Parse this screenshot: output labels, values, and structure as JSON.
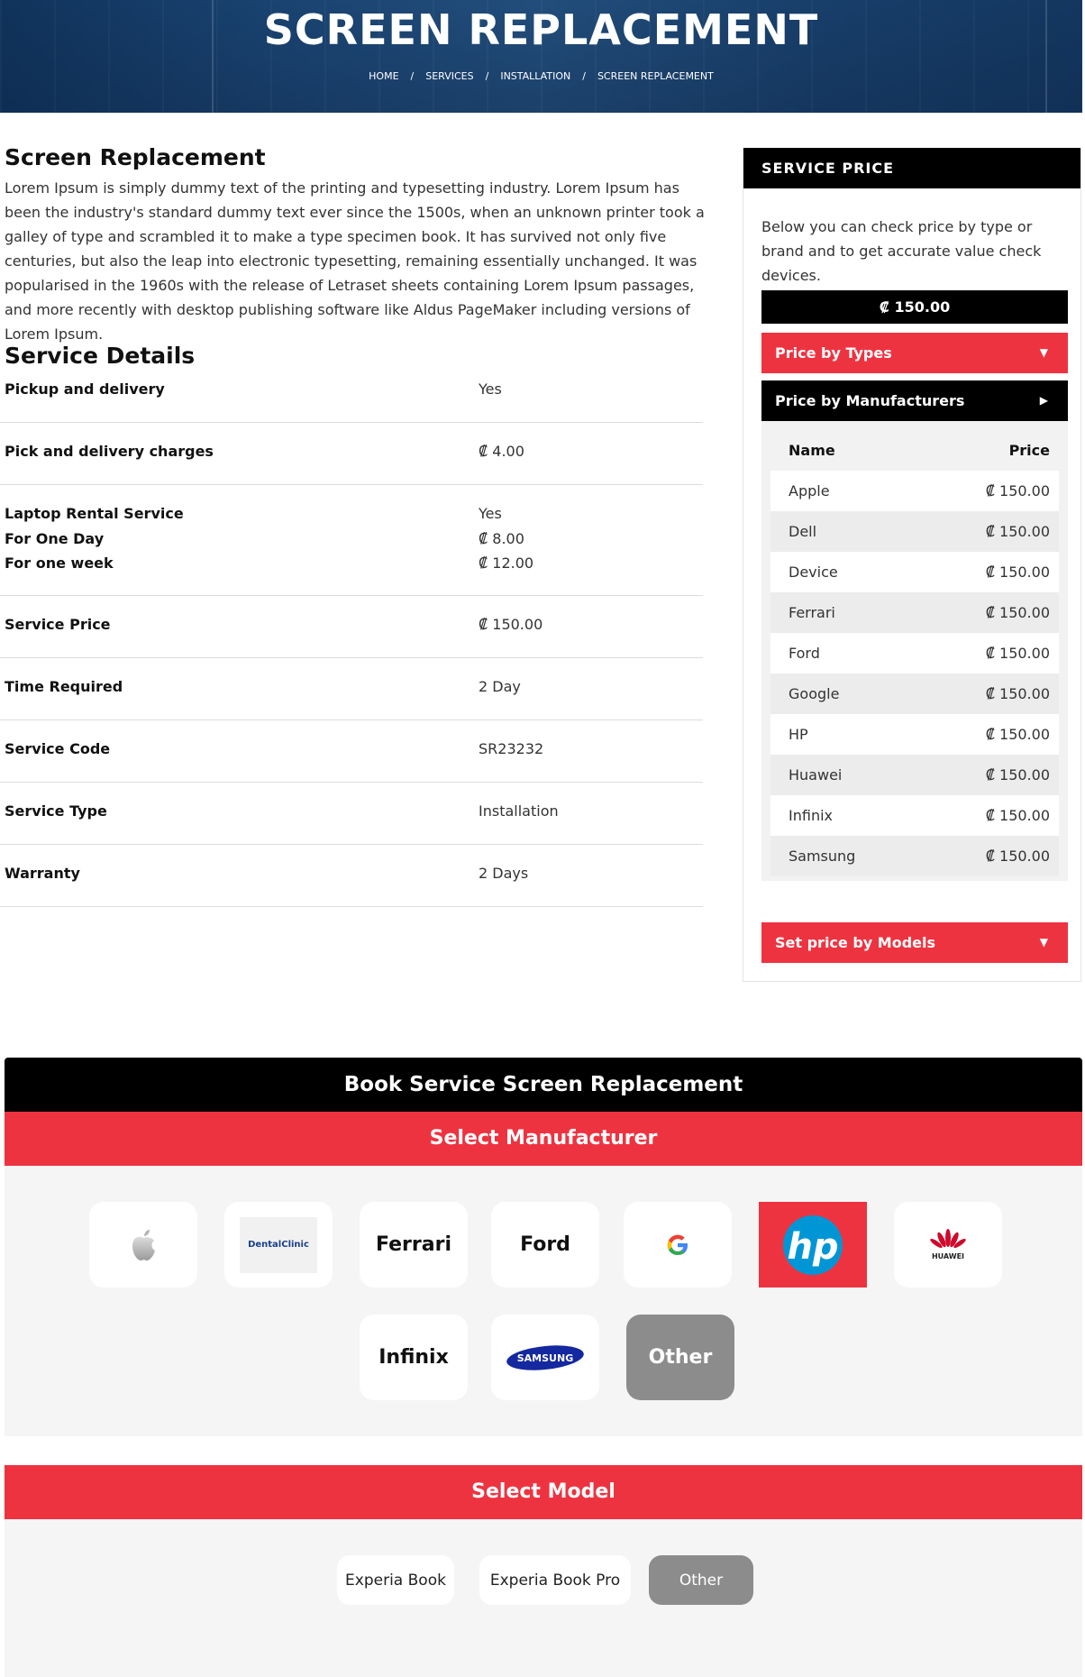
{
  "hero": {
    "title": "SCREEN REPLACEMENT",
    "breadcrumb": [
      "HOME",
      "SERVICES",
      "INSTALLATION",
      "SCREEN REPLACEMENT"
    ],
    "separator": "/"
  },
  "intro": {
    "title": "Screen Replacement",
    "text": "Lorem Ipsum is simply dummy text of the printing and typesetting industry. Lorem Ipsum has been the industry's standard dummy text ever since the 1500s, when an unknown printer took a galley of type and scrambled it to make a type specimen book. It has survived not only five centuries, but also the leap into electronic typesetting, remaining essentially unchanged. It was popularised in the 1960s with the release of Letraset sheets containing Lorem Ipsum passages, and more recently with desktop publishing software like Aldus PageMaker including versions of Lorem Ipsum."
  },
  "details": {
    "title": "Service Details",
    "rows": [
      {
        "label": "Pickup and delivery",
        "value": "Yes"
      },
      {
        "label": "Pick and delivery charges",
        "value": "₡ 4.00"
      },
      {
        "label": "Laptop Rental Service",
        "value": "Yes",
        "sub": [
          {
            "label": "For One Day",
            "value": "₡ 8.00"
          },
          {
            "label": "For one week",
            "value": "₡ 12.00"
          }
        ]
      },
      {
        "label": "Service Price",
        "value": "₡ 150.00"
      },
      {
        "label": "Time Required",
        "value": "2 Day"
      },
      {
        "label": "Service Code",
        "value": "SR23232"
      },
      {
        "label": "Service Type",
        "value": "Installation"
      },
      {
        "label": "Warranty",
        "value": "2 Days"
      }
    ]
  },
  "sidebar": {
    "title": "SERVICE PRICE",
    "text": "Below you can check price by type or brand and to get accurate value check devices.",
    "price": "₡ 150.00",
    "btn_types": "Price by Types",
    "btn_manufacturers": "Price by Manufacturers",
    "btn_models": "Set price by Models",
    "table_head": {
      "name": "Name",
      "price": "Price"
    },
    "table_rows": [
      {
        "name": "Apple",
        "price": "₡ 150.00"
      },
      {
        "name": "Dell",
        "price": "₡ 150.00"
      },
      {
        "name": "Device",
        "price": "₡ 150.00"
      },
      {
        "name": "Ferrari",
        "price": "₡ 150.00"
      },
      {
        "name": "Ford",
        "price": "₡ 150.00"
      },
      {
        "name": "Google",
        "price": "₡ 150.00"
      },
      {
        "name": "HP",
        "price": "₡ 150.00"
      },
      {
        "name": "Huawei",
        "price": "₡ 150.00"
      },
      {
        "name": "Infinix",
        "price": "₡ 150.00"
      },
      {
        "name": "Samsung",
        "price": "₡ 150.00"
      }
    ]
  },
  "booking": {
    "title": "Book Service Screen Replacement",
    "select_manufacturer": "Select Manufacturer",
    "manufacturers": [
      {
        "label": "",
        "logo": "apple-logo"
      },
      {
        "label": "DentalClinic",
        "logo": "dentalclinic-logo"
      },
      {
        "label": "Ferrari",
        "logo": ""
      },
      {
        "label": "Ford",
        "logo": ""
      },
      {
        "label": "",
        "logo": "google-logo"
      },
      {
        "label": "",
        "logo": "hp-logo",
        "selected": true
      },
      {
        "label": "HUAWEI",
        "logo": "huawei-logo"
      },
      {
        "label": "Infinix",
        "logo": ""
      },
      {
        "label": "SAMSUNG",
        "logo": "samsung-logo"
      },
      {
        "label": "Other",
        "logo": ""
      }
    ],
    "select_model": "Select Model",
    "models": [
      "Experia Book",
      "Experia Book Pro",
      "Other"
    ]
  },
  "colors": {
    "accent_red": "#ee3340",
    "black": "#000000",
    "other_gray": "#8c8c8c"
  }
}
